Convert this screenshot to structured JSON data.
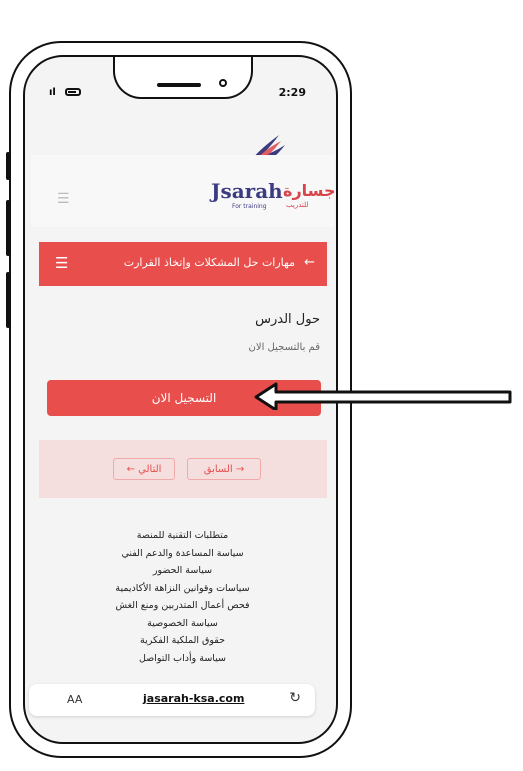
{
  "status_bar": {
    "time": "2:29"
  },
  "header": {
    "logo_text": "Jsarah",
    "logo_arabic": "جسارة",
    "logo_subtitle": "For training",
    "logo_arabic_sub": "للتدريب"
  },
  "course_bar": {
    "title": "مهارات حل المشكلات وإتخاذ القرارت"
  },
  "lesson": {
    "heading": "حول الدرس",
    "hint": "قم بالتسجيل الان",
    "register_label": "التسجيل الان"
  },
  "navigation": {
    "prev_label": "السابق",
    "next_label": "التالي"
  },
  "footer": {
    "links": [
      "متطلبات التقنية للمنصة",
      "سياسة المساعدة والدعم الفني",
      "سياسة الحضور",
      "سياسات وقوانين النزاهة الأكاديمية",
      "فحص أعمال المتدربين ومنع الغش",
      "سياسة الخصوصية",
      "حقوق الملكية الفكرية",
      "سياسة وأداب التواصل"
    ]
  },
  "browser": {
    "text_size": "AA",
    "url": "jasarah-ksa.com"
  },
  "colors": {
    "accent": "#e74e4c",
    "brand_blue": "#3b3b82"
  },
  "icons": [
    "hamburger-icon",
    "back-arrow-icon",
    "reload-icon",
    "pointer-arrow-icon"
  ]
}
